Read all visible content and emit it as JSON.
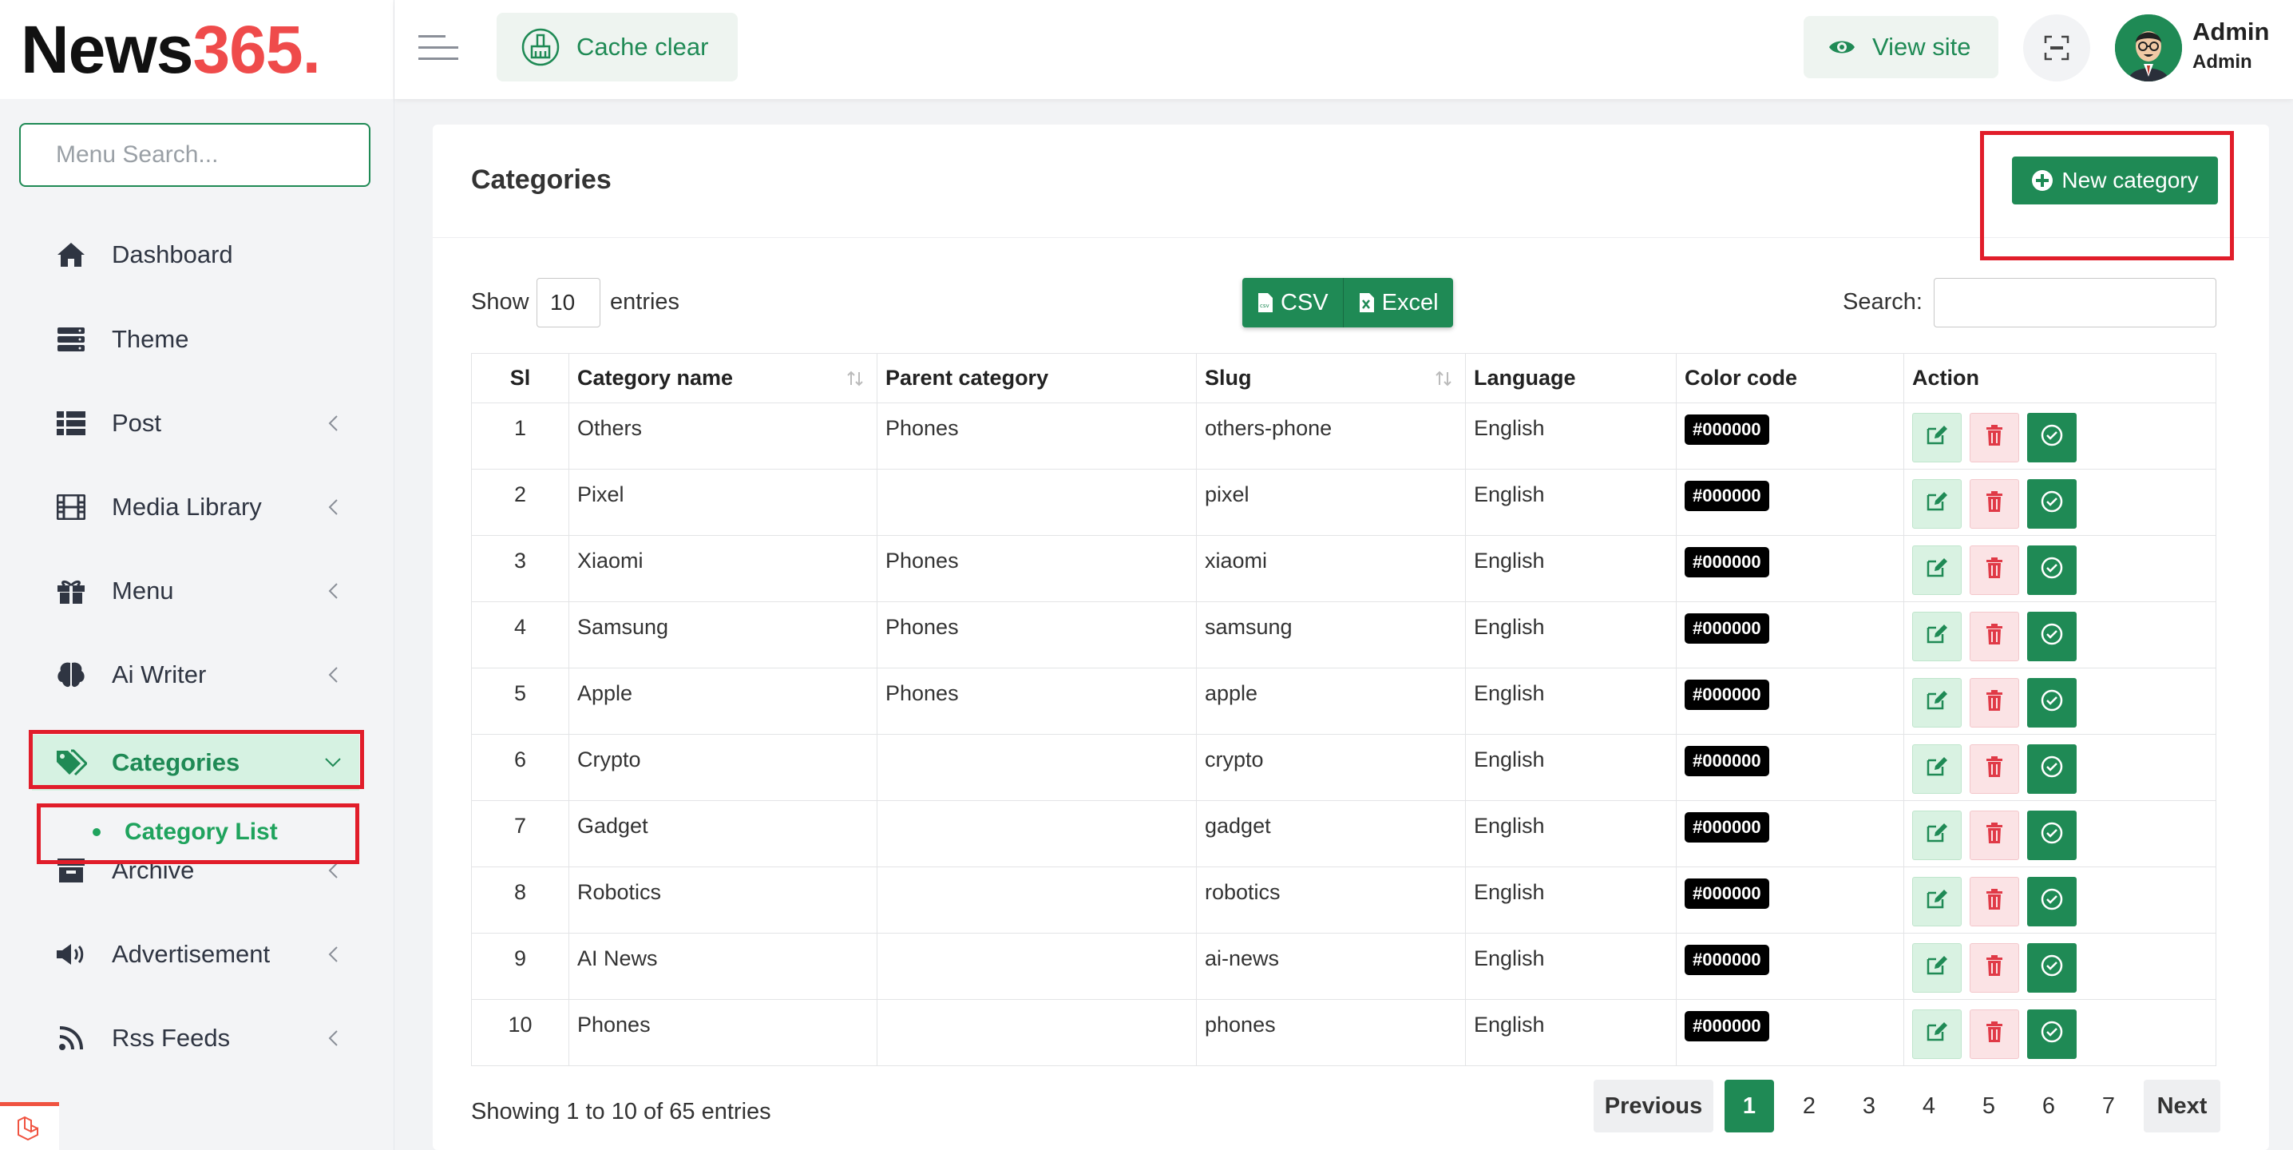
{
  "logo": {
    "text": "News",
    "number": "365.",
    "brand_color": "#ef4b4b"
  },
  "sidebar": {
    "search_placeholder": "Menu Search...",
    "items": [
      {
        "label": "Dashboard",
        "icon": "home-icon",
        "has_chevron": false
      },
      {
        "label": "Theme",
        "icon": "server-icon",
        "has_chevron": false
      },
      {
        "label": "Post",
        "icon": "list-icon",
        "has_chevron": true
      },
      {
        "label": "Media Library",
        "icon": "film-icon",
        "has_chevron": true
      },
      {
        "label": "Menu",
        "icon": "gift-icon",
        "has_chevron": true
      },
      {
        "label": "Ai Writer",
        "icon": "brain-icon",
        "has_chevron": true
      },
      {
        "label": "Categories",
        "icon": "tags-icon",
        "has_chevron": true,
        "active": true
      },
      {
        "label": "Archive",
        "icon": "archive-icon",
        "has_chevron": true
      },
      {
        "label": "Advertisement",
        "icon": "megaphone-icon",
        "has_chevron": true
      },
      {
        "label": "Rss Feeds",
        "icon": "rss-icon",
        "has_chevron": true
      }
    ],
    "sub_item": {
      "label": "Category List"
    }
  },
  "topbar": {
    "cache_clear_label": "Cache clear",
    "view_site_label": "View site",
    "user_name": "Admin",
    "user_role": "Admin"
  },
  "page": {
    "title": "Categories",
    "new_button_label": "New category",
    "show_label": "Show",
    "entries_value": "10",
    "entries_label": "entries",
    "csv_label": "CSV",
    "excel_label": "Excel",
    "search_label": "Search:",
    "columns": [
      "Sl",
      "Category name",
      "Parent category",
      "Slug",
      "Language",
      "Color code",
      "Action"
    ],
    "rows": [
      {
        "sl": "1",
        "name": "Others",
        "parent": "Phones",
        "slug": "others-phone",
        "language": "English",
        "color": "#000000"
      },
      {
        "sl": "2",
        "name": "Pixel",
        "parent": "",
        "slug": "pixel",
        "language": "English",
        "color": "#000000"
      },
      {
        "sl": "3",
        "name": "Xiaomi",
        "parent": "Phones",
        "slug": "xiaomi",
        "language": "English",
        "color": "#000000"
      },
      {
        "sl": "4",
        "name": "Samsung",
        "parent": "Phones",
        "slug": "samsung",
        "language": "English",
        "color": "#000000"
      },
      {
        "sl": "5",
        "name": "Apple",
        "parent": "Phones",
        "slug": "apple",
        "language": "English",
        "color": "#000000"
      },
      {
        "sl": "6",
        "name": "Crypto",
        "parent": "",
        "slug": "crypto",
        "language": "English",
        "color": "#000000"
      },
      {
        "sl": "7",
        "name": "Gadget",
        "parent": "",
        "slug": "gadget",
        "language": "English",
        "color": "#000000"
      },
      {
        "sl": "8",
        "name": "Robotics",
        "parent": "",
        "slug": "robotics",
        "language": "English",
        "color": "#000000"
      },
      {
        "sl": "9",
        "name": "AI News",
        "parent": "",
        "slug": "ai-news",
        "language": "English",
        "color": "#000000"
      },
      {
        "sl": "10",
        "name": "Phones",
        "parent": "",
        "slug": "phones",
        "language": "English",
        "color": "#000000"
      }
    ],
    "info_text": "Showing 1 to 10 of 65 entries",
    "pagination": {
      "prev": "Previous",
      "pages": [
        "1",
        "2",
        "3",
        "4",
        "5",
        "6",
        "7"
      ],
      "current": "1",
      "next": "Next"
    }
  },
  "colors": {
    "accent": "#1f8a55",
    "highlight_box": "#e11d2a",
    "delete": "#e03a47"
  }
}
